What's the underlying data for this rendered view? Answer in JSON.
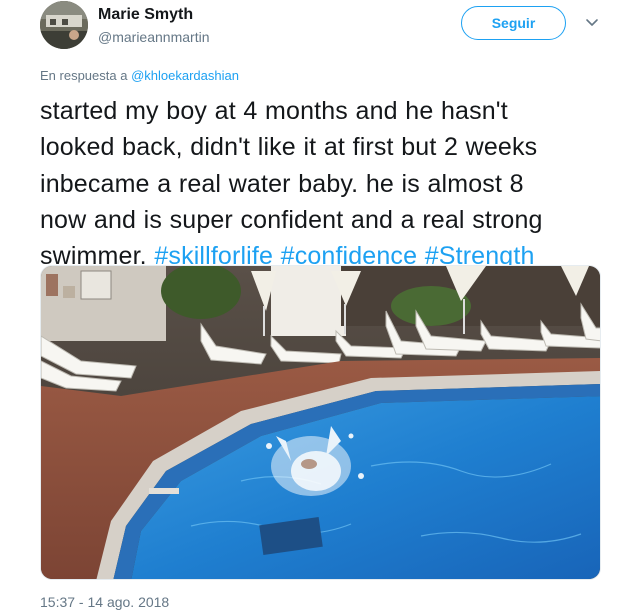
{
  "author": {
    "name": "Marie Smyth",
    "handle": "@marieannmartin"
  },
  "follow": {
    "label": "Seguir"
  },
  "icons": {
    "caret": "chevron-down-icon"
  },
  "reply": {
    "prefix": "En respuesta a",
    "mention": "@khloekardashian"
  },
  "tweet": {
    "lines": [
      "started my boy at 4 months and he hasn't",
      "looked back, didn't like it at first but 2 weeks",
      "inbecame a real water baby.  he is almost 8",
      "now and is super confident and a real strong"
    ],
    "last_line_text": "swimmer.",
    "hashtags": [
      "#skillforlife",
      "#confidence",
      "#Strength"
    ]
  },
  "timestamp": "15:37 - 14 ago. 2018",
  "colors": {
    "accent": "#1da1f2",
    "text": "#14171a",
    "secondary": "#657786"
  }
}
